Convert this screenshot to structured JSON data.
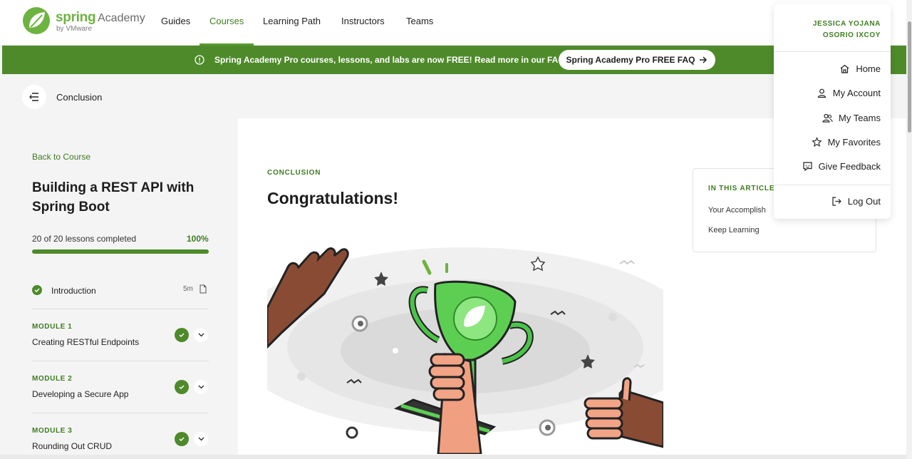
{
  "brand": {
    "name": "spring",
    "product": "Academy",
    "byline": "by VMware",
    "accent": "#6db33f",
    "banner_green": "#4e8a2a"
  },
  "nav": {
    "items": [
      {
        "label": "Guides"
      },
      {
        "label": "Courses",
        "active": true
      },
      {
        "label": "Learning Path"
      },
      {
        "label": "Instructors"
      },
      {
        "label": "Teams"
      }
    ]
  },
  "banner": {
    "icon": "info-icon",
    "text": "Spring Academy Pro courses, lessons, and labs are now FREE! Read more in our FAQ.",
    "button_label": "Spring Academy Pro FREE FAQ",
    "button_icon": "arrow-right-icon"
  },
  "lesson_header": {
    "back_icon": "collapse-menu-icon",
    "title": "Conclusion"
  },
  "sidebar": {
    "back_link": "Back to Course",
    "course_title": "Building a REST API with Spring Boot",
    "progress_label": "20 of 20 lessons completed",
    "progress_percent": "100%",
    "progress_fraction": 1.0,
    "intro": {
      "label": "Introduction",
      "duration": "5m",
      "icon": "document-icon",
      "completed": true
    },
    "modules": [
      {
        "eyebrow": "MODULE 1",
        "name": "Creating RESTful Endpoints",
        "completed": true
      },
      {
        "eyebrow": "MODULE 2",
        "name": "Developing a Secure App",
        "completed": true
      },
      {
        "eyebrow": "MODULE 3",
        "name": "Rounding Out CRUD",
        "completed": true
      }
    ]
  },
  "article": {
    "eyebrow": "CONCLUSION",
    "title": "Congratulations!",
    "hero_icon": "trophy-illustration"
  },
  "toc": {
    "heading": "IN THIS ARTICLE",
    "items": [
      "Your Accomplish",
      "Keep Learning"
    ]
  },
  "user_menu": {
    "user_line1": "JESSICA YOJANA",
    "user_line2": "OSORIO IXCOY",
    "items": [
      {
        "label": "Home",
        "icon": "home-icon"
      },
      {
        "label": "My Account",
        "icon": "user-icon"
      },
      {
        "label": "My Teams",
        "icon": "team-icon"
      },
      {
        "label": "My Favorites",
        "icon": "star-icon"
      },
      {
        "label": "Give Feedback",
        "icon": "feedback-icon"
      }
    ],
    "logout": {
      "label": "Log Out",
      "icon": "logout-icon"
    }
  }
}
